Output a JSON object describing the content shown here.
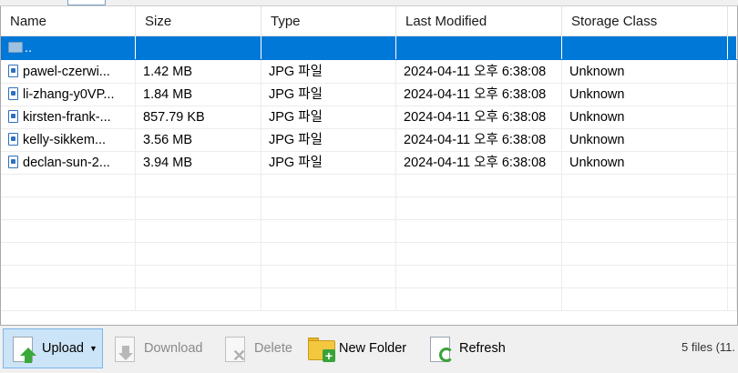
{
  "columns": [
    "Name",
    "Size",
    "Type",
    "Last Modified",
    "Storage Class"
  ],
  "parent_row": {
    "name": ".."
  },
  "files": [
    {
      "name": "pawel-czerwi...",
      "size": "1.42 MB",
      "type": "JPG 파일",
      "modified": "2024-04-11 오후 6:38:08",
      "storage": "Unknown"
    },
    {
      "name": "li-zhang-y0VP...",
      "size": "1.84 MB",
      "type": "JPG 파일",
      "modified": "2024-04-11 오후 6:38:08",
      "storage": "Unknown"
    },
    {
      "name": "kirsten-frank-...",
      "size": "857.79 KB",
      "type": "JPG 파일",
      "modified": "2024-04-11 오후 6:38:08",
      "storage": "Unknown"
    },
    {
      "name": "kelly-sikkem...",
      "size": "3.56 MB",
      "type": "JPG 파일",
      "modified": "2024-04-11 오후 6:38:08",
      "storage": "Unknown"
    },
    {
      "name": "declan-sun-2...",
      "size": "3.94 MB",
      "type": "JPG 파일",
      "modified": "2024-04-11 오후 6:38:08",
      "storage": "Unknown"
    }
  ],
  "toolbar": {
    "upload": "Upload",
    "download": "Download",
    "delete": "Delete",
    "new_folder": "New Folder",
    "refresh": "Refresh"
  },
  "status": "5 files (11.",
  "colors": {
    "selection": "#0078d7",
    "upload_bg": "#cce4f7"
  }
}
